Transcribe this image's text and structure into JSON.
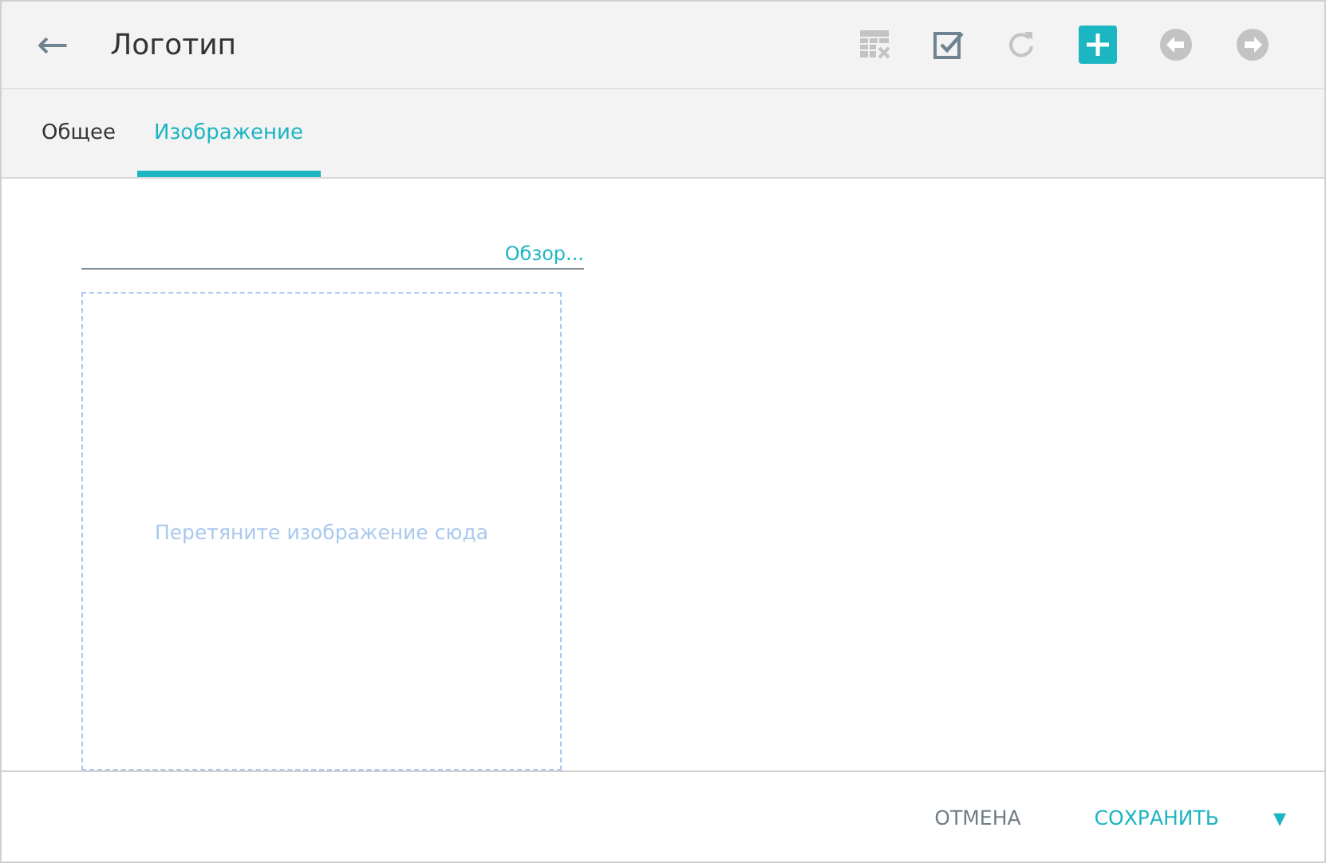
{
  "header": {
    "back": "←",
    "title": "Логотип",
    "tools": [
      {
        "kind": "table-delete",
        "disabled": true
      },
      {
        "kind": "check",
        "disabled": false
      },
      {
        "kind": "refresh",
        "disabled": true
      },
      {
        "kind": "add",
        "disabled": false
      },
      {
        "kind": "prev",
        "disabled": true
      },
      {
        "kind": "next",
        "disabled": true
      }
    ]
  },
  "tabs": [
    {
      "label": "Общее",
      "selected": false
    },
    {
      "label": "Изображение",
      "selected": true
    }
  ],
  "image_field": {
    "browse": "Обзор...",
    "drop_hint": "Перетяните изображение сюда"
  },
  "footer": {
    "buttons": [
      {
        "label": "ОТМЕНА",
        "kind": "secondary"
      },
      {
        "label": "СОХРАНИТЬ",
        "kind": "primary"
      }
    ],
    "menu": "▾"
  }
}
